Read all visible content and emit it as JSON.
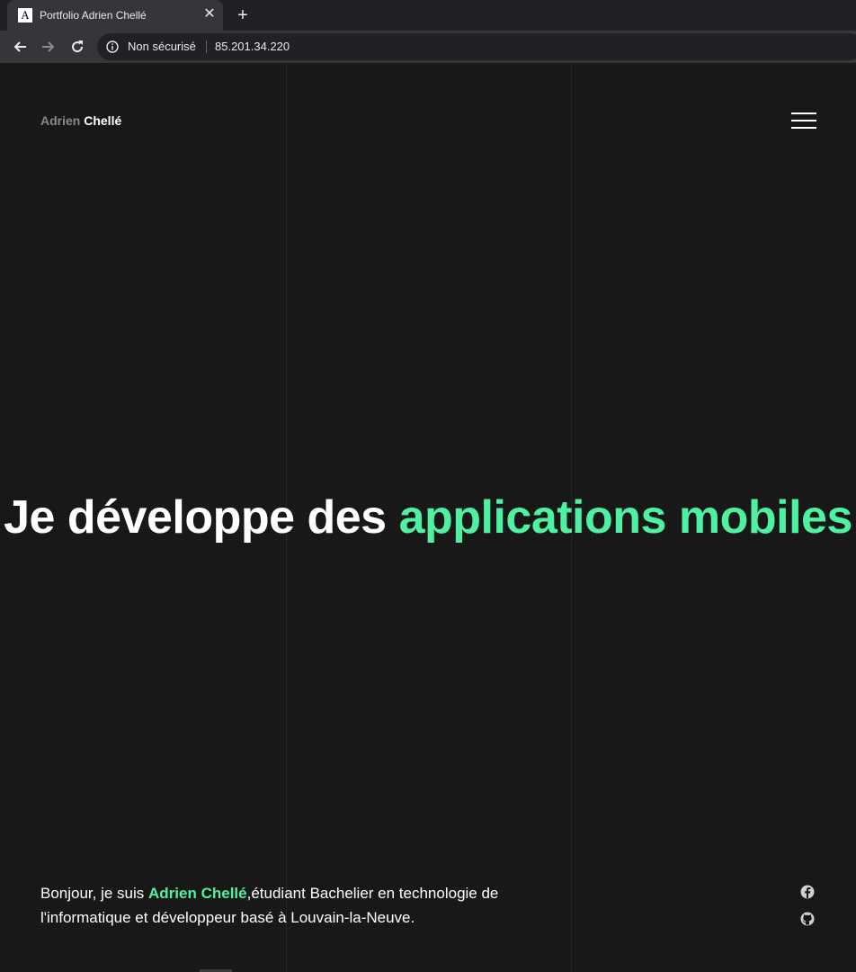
{
  "browser": {
    "tab": {
      "favicon_letter": "A",
      "title": "Portfolio Adrien Chellé",
      "close_icon": "close-icon"
    },
    "new_tab_icon": "plus-icon",
    "nav": {
      "back_icon": "arrow-left-icon",
      "forward_icon": "arrow-right-icon",
      "reload_icon": "reload-icon"
    },
    "omnibox": {
      "security_icon": "info-icon",
      "security_label": "Non sécurisé",
      "url": "85.201.34.220"
    }
  },
  "site": {
    "logo": {
      "first": "Adrien",
      "last": "Chellé"
    },
    "menu_icon": "hamburger-menu-icon",
    "hero": {
      "lead": "Je développe des",
      "accent": "applications mobiles"
    },
    "intro": {
      "prefix": "Bonjour, je suis",
      "name": "Adrien Chellé",
      "suffix": ",étudiant Bachelier en technologie de l'informatique et développeur basé à Louvain-la-Neuve."
    },
    "social": [
      "facebook-icon",
      "github-icon"
    ]
  },
  "colors": {
    "background": "#161616",
    "accent": "#4ef0a2",
    "text": "#ffffff",
    "muted": "#8a8a8a"
  }
}
